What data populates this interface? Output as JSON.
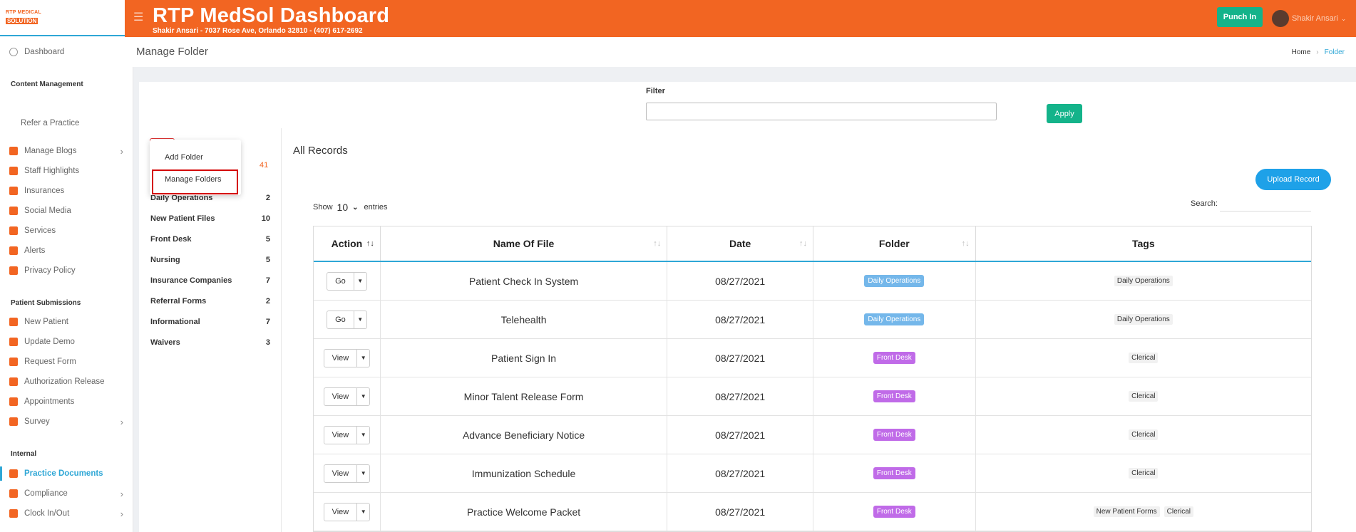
{
  "app": {
    "logo_line1": "RTP MEDICAL",
    "logo_line2": "SOLUTION",
    "title": "RTP MedSol Dashboard",
    "subtitle": "Shakir Ansari - 7037 Rose Ave, Orlando 32810 - (407) 617-2692",
    "punch_label": "Punch In",
    "user_name": "Shakir Ansari"
  },
  "sidebar": {
    "dashboard": "Dashboard",
    "content_mgmt": "Content Management",
    "refer": "Refer a Practice",
    "patient_sub": "Patient Submissions",
    "internal": "Internal",
    "items": [
      {
        "label": "Manage Blogs",
        "chev": "›"
      },
      {
        "label": "Staff Highlights",
        "chev": ""
      },
      {
        "label": "Insurances",
        "chev": ""
      },
      {
        "label": "Social Media",
        "chev": ""
      },
      {
        "label": "Services",
        "chev": ""
      },
      {
        "label": "Alerts",
        "chev": ""
      },
      {
        "label": "Privacy Policy",
        "chev": ""
      }
    ],
    "patient_items": [
      {
        "label": "New Patient",
        "chev": ""
      },
      {
        "label": "Update Demo",
        "chev": ""
      },
      {
        "label": "Request Form",
        "chev": ""
      },
      {
        "label": "Authorization Release",
        "chev": ""
      },
      {
        "label": "Appointments",
        "chev": ""
      },
      {
        "label": "Survey",
        "chev": "›"
      }
    ],
    "internal_items": [
      {
        "label": "Practice Documents",
        "chev": ""
      },
      {
        "label": "Compliance",
        "chev": "›"
      },
      {
        "label": "Clock In/Out",
        "chev": "›"
      }
    ]
  },
  "page": {
    "title": "Manage Folder",
    "crumb_home": "Home",
    "crumb_sep": "›",
    "crumb_current": "Folder"
  },
  "filter": {
    "label": "Filter",
    "value": "",
    "apply": "Apply"
  },
  "menu": {
    "add_folder": "Add Folder",
    "manage_folders": "Manage Folders",
    "total": "41"
  },
  "folders": [
    {
      "name": "Daily Operations",
      "count": "2"
    },
    {
      "name": "New Patient Files",
      "count": "10"
    },
    {
      "name": "Front Desk",
      "count": "5"
    },
    {
      "name": "Nursing",
      "count": "5"
    },
    {
      "name": "Insurance Companies",
      "count": "7"
    },
    {
      "name": "Referral Forms",
      "count": "2"
    },
    {
      "name": "Informational",
      "count": "7"
    },
    {
      "name": "Waivers",
      "count": "3"
    }
  ],
  "records": {
    "title": "All Records",
    "upload": "Upload Record",
    "show": "Show",
    "entries_value": "10",
    "entries": "entries",
    "search": "Search:",
    "headers": [
      "Action",
      "Name Of File",
      "Date",
      "Folder",
      "Tags"
    ],
    "rows": [
      {
        "action": "Go",
        "name": "Patient Check In System",
        "date": "08/27/2021",
        "folder": "Daily Operations",
        "folder_color": "#74b7ea",
        "tags": [
          "Daily Operations"
        ]
      },
      {
        "action": "Go",
        "name": "Telehealth",
        "date": "08/27/2021",
        "folder": "Daily Operations",
        "folder_color": "#74b7ea",
        "tags": [
          "Daily Operations"
        ]
      },
      {
        "action": "View",
        "name": "Patient Sign In",
        "date": "08/27/2021",
        "folder": "Front Desk",
        "folder_color": "#c06be8",
        "tags": [
          "Clerical"
        ]
      },
      {
        "action": "View",
        "name": "Minor Talent Release Form",
        "date": "08/27/2021",
        "folder": "Front Desk",
        "folder_color": "#c06be8",
        "tags": [
          "Clerical"
        ]
      },
      {
        "action": "View",
        "name": "Advance Beneficiary Notice",
        "date": "08/27/2021",
        "folder": "Front Desk",
        "folder_color": "#c06be8",
        "tags": [
          "Clerical"
        ]
      },
      {
        "action": "View",
        "name": "Immunization Schedule",
        "date": "08/27/2021",
        "folder": "Front Desk",
        "folder_color": "#c06be8",
        "tags": [
          "Clerical"
        ]
      },
      {
        "action": "View",
        "name": "Practice Welcome Packet",
        "date": "08/27/2021",
        "folder": "Front Desk",
        "folder_color": "#c06be8",
        "tags": [
          "New Patient Forms",
          "Clerical"
        ]
      }
    ]
  }
}
